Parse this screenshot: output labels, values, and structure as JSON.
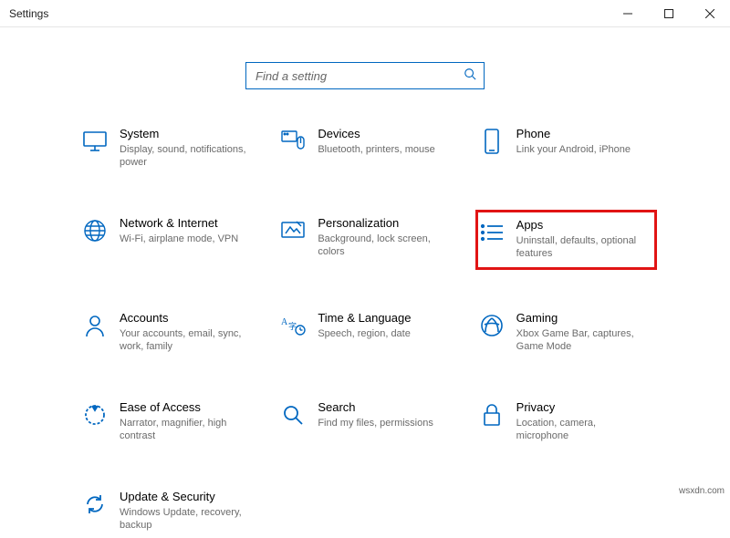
{
  "window": {
    "title": "Settings"
  },
  "search": {
    "placeholder": "Find a setting"
  },
  "tiles": [
    {
      "title": "System",
      "desc": "Display, sound, notifications, power"
    },
    {
      "title": "Devices",
      "desc": "Bluetooth, printers, mouse"
    },
    {
      "title": "Phone",
      "desc": "Link your Android, iPhone"
    },
    {
      "title": "Network & Internet",
      "desc": "Wi-Fi, airplane mode, VPN"
    },
    {
      "title": "Personalization",
      "desc": "Background, lock screen, colors"
    },
    {
      "title": "Apps",
      "desc": "Uninstall, defaults, optional features"
    },
    {
      "title": "Accounts",
      "desc": "Your accounts, email, sync, work, family"
    },
    {
      "title": "Time & Language",
      "desc": "Speech, region, date"
    },
    {
      "title": "Gaming",
      "desc": "Xbox Game Bar, captures, Game Mode"
    },
    {
      "title": "Ease of Access",
      "desc": "Narrator, magnifier, high contrast"
    },
    {
      "title": "Search",
      "desc": "Find my files, permissions"
    },
    {
      "title": "Privacy",
      "desc": "Location, camera, microphone"
    },
    {
      "title": "Update & Security",
      "desc": "Windows Update, recovery, backup"
    }
  ],
  "watermark": "wsxdn.com"
}
